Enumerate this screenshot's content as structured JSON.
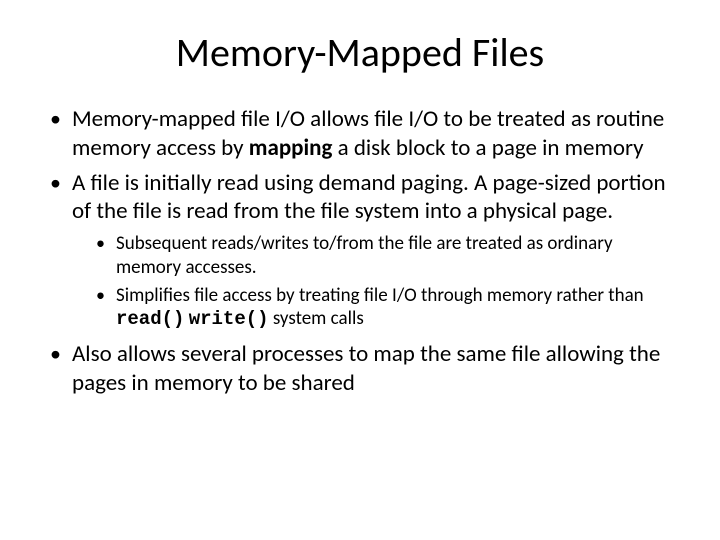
{
  "title": "Memory-Mapped Files",
  "b1": {
    "pre": "Memory-mapped file I/O allows file I/O to be treated as routine memory access by ",
    "bold": "mapping",
    "post": " a disk block to a page in memory"
  },
  "b2": "A file is initially read using demand paging. A page-sized portion of the file is read from the file system into a physical page.",
  "b2s1": "Subsequent reads/writes to/from the file are treated as ordinary memory accesses.",
  "b2s2": {
    "pre": "Simplifies file access by treating file I/O through memory rather than ",
    "code1": "read()",
    "mid": " ",
    "code2": "write()",
    "post": " system calls"
  },
  "b3": "Also allows several processes to map the same file allowing the pages in memory to be shared"
}
